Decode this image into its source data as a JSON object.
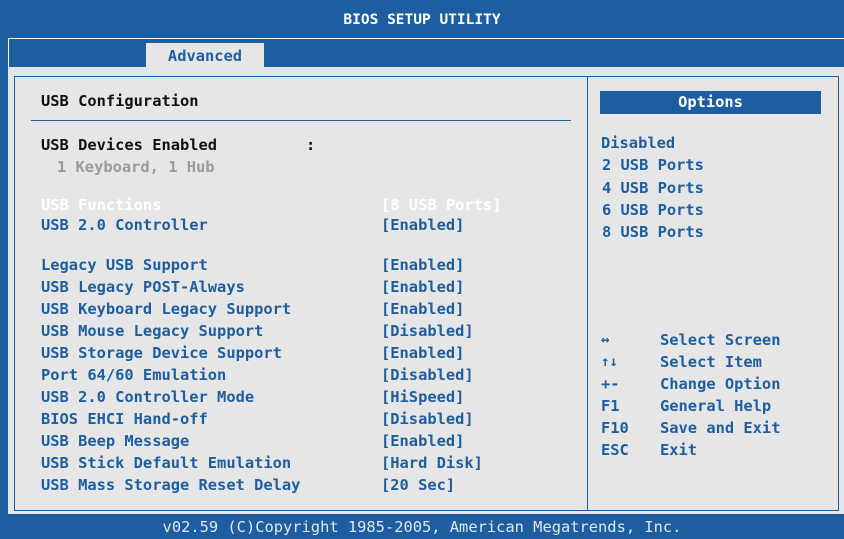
{
  "title": "BIOS SETUP UTILITY",
  "active_tab": "Advanced",
  "section_title": "USB Configuration",
  "devices": {
    "label": "USB Devices Enabled",
    "colon": ":",
    "value": "1 Keyboard, 1 Hub"
  },
  "settings": [
    {
      "label": "USB Functions",
      "value": "[8 USB Ports]",
      "selected": true
    },
    {
      "label": "USB 2.0 Controller",
      "value": "[Enabled]"
    },
    {
      "label": "Legacy USB Support",
      "value": "[Enabled]"
    },
    {
      "label": "USB Legacy POST-Always",
      "value": "[Enabled]"
    },
    {
      "label": "USB Keyboard Legacy Support",
      "value": "[Enabled]"
    },
    {
      "label": "USB Mouse Legacy Support",
      "value": "[Disabled]"
    },
    {
      "label": "USB Storage Device Support",
      "value": "[Enabled]"
    },
    {
      "label": "Port 64/60 Emulation",
      "value": "[Disabled]"
    },
    {
      "label": "USB 2.0 Controller Mode",
      "value": "[HiSpeed]"
    },
    {
      "label": "BIOS EHCI Hand-off",
      "value": "[Disabled]"
    },
    {
      "label": "USB Beep Message",
      "value": "[Enabled]"
    },
    {
      "label": "USB Stick Default Emulation",
      "value": "[Hard Disk]"
    },
    {
      "label": "USB Mass Storage Reset Delay",
      "value": "[20 Sec]"
    }
  ],
  "options_header": "Options",
  "options": [
    "Disabled",
    "2 USB Ports",
    "4 USB Ports",
    "6 USB Ports",
    "8 USB Ports"
  ],
  "help_keys": [
    {
      "key": "↔",
      "icon": "left-right-arrow-icon",
      "desc": "Select Screen"
    },
    {
      "key": "↑↓",
      "icon": "up-down-arrow-icon",
      "desc": "Select Item"
    },
    {
      "key": "+-",
      "desc": "Change Option"
    },
    {
      "key": "F1",
      "desc": "General Help"
    },
    {
      "key": "F10",
      "desc": "Save and Exit"
    },
    {
      "key": "ESC",
      "desc": "Exit"
    }
  ],
  "footer": "v02.59 (C)Copyright 1985-2005, American Megatrends, Inc.",
  "colors": {
    "frame_blue": "#1d5ea0",
    "panel_gray": "#e6e6e6",
    "disabled_gray": "#9a9a9a",
    "selected_text": "#ffffff"
  }
}
